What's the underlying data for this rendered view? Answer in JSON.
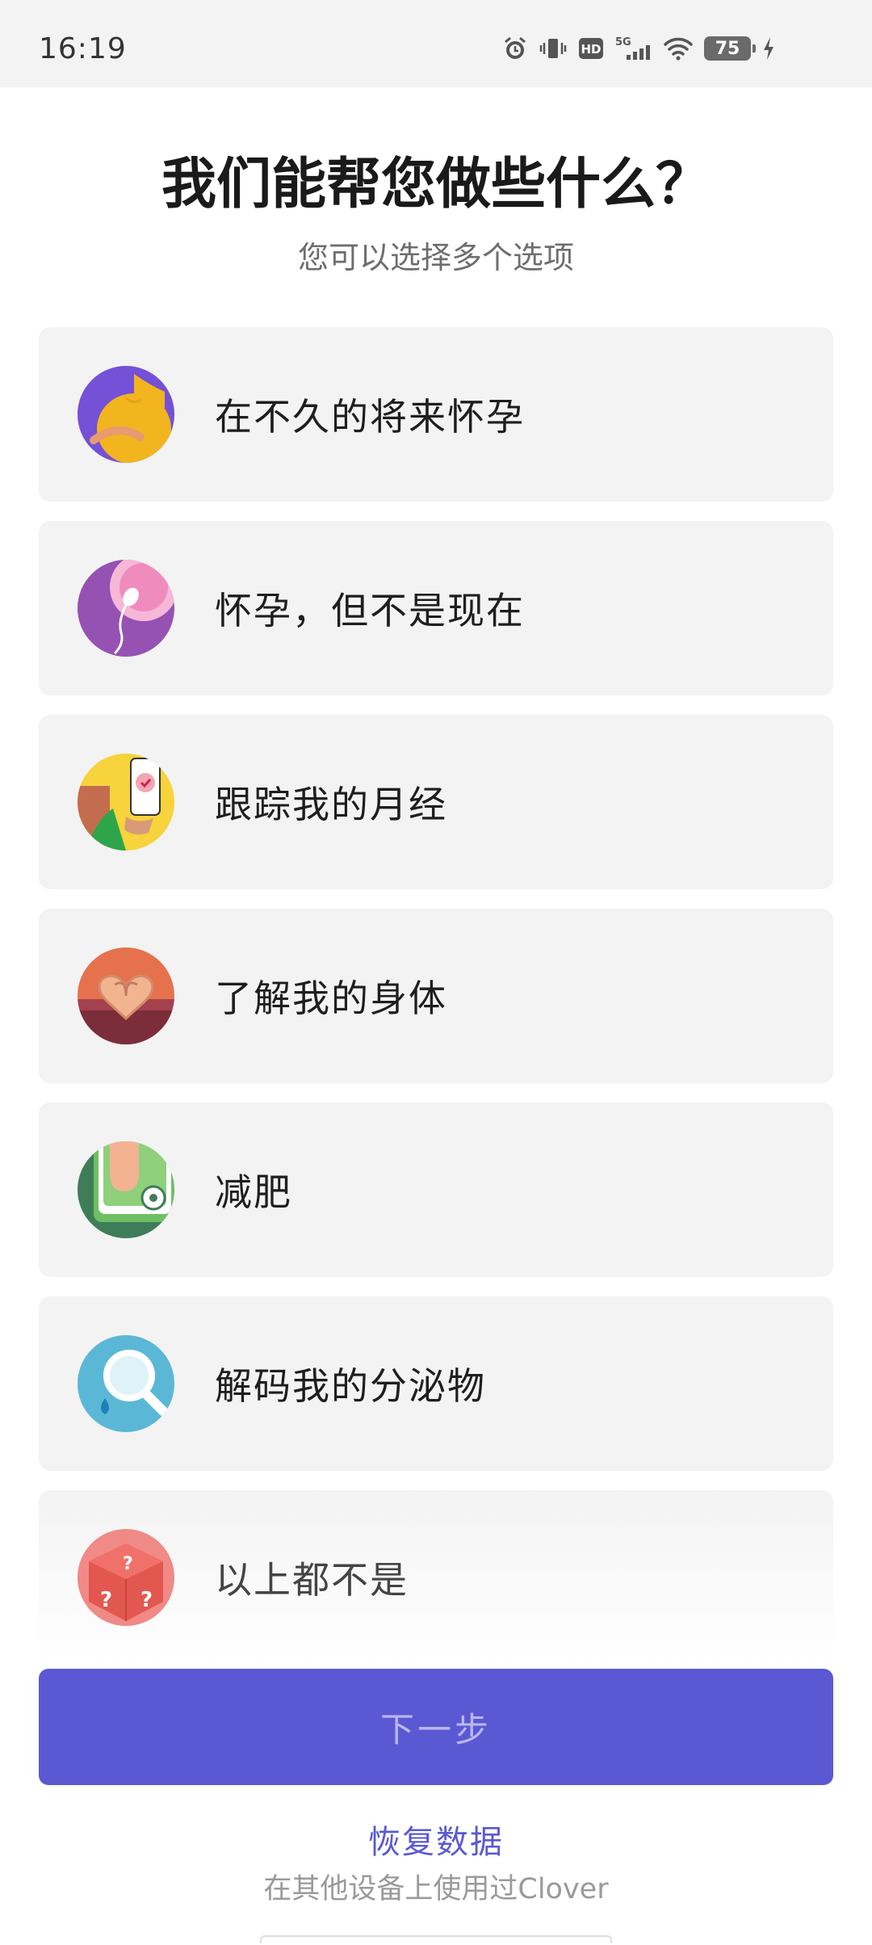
{
  "status_bar": {
    "time": "16:19",
    "network": "5G",
    "hd": "HD",
    "battery": "75"
  },
  "header": {
    "title": "我们能帮您做些什么？",
    "subtitle": "您可以选择多个选项"
  },
  "options": [
    {
      "label": "在不久的将来怀孕",
      "icon": "pregnant-belly-icon"
    },
    {
      "label": "怀孕，但不是现在",
      "icon": "sperm-egg-icon"
    },
    {
      "label": "跟踪我的月经",
      "icon": "period-tracker-phone-icon"
    },
    {
      "label": "了解我的身体",
      "icon": "heart-hands-icon"
    },
    {
      "label": "减肥",
      "icon": "scale-foot-icon"
    },
    {
      "label": "解码我的分泌物",
      "icon": "magnifier-drop-icon"
    },
    {
      "label": "以上都不是",
      "icon": "mystery-box-icon"
    }
  ],
  "footer": {
    "next_label": "下一步",
    "restore_label": "恢复数据",
    "restore_sub": "在其他设备上使用过Clover"
  },
  "colors": {
    "accent": "#5b58d4",
    "card": "#f3f3f3"
  }
}
